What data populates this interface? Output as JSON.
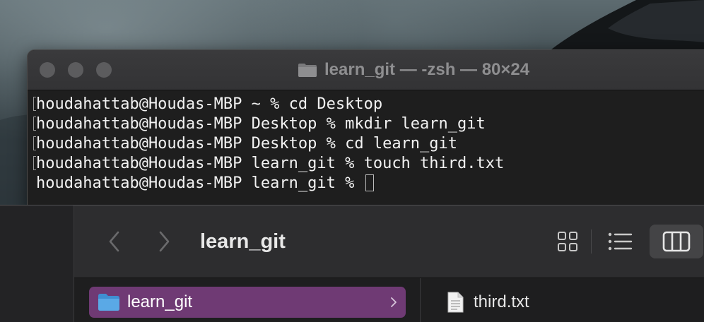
{
  "terminal": {
    "title": "learn_git — -zsh — 80×24",
    "title_icon": "folder-icon",
    "lines": [
      {
        "text": "houdahattab@Houdas-MBP ~ % cd Desktop",
        "marked": true
      },
      {
        "text": "houdahattab@Houdas-MBP Desktop % mkdir learn_git",
        "marked": true
      },
      {
        "text": "houdahattab@Houdas-MBP Desktop % cd learn_git",
        "marked": true
      },
      {
        "text": "houdahattab@Houdas-MBP learn_git % touch third.txt",
        "marked": true
      },
      {
        "text": "houdahattab@Houdas-MBP learn_git % ",
        "marked": false,
        "cursor": true
      }
    ]
  },
  "finder": {
    "title": "learn_git",
    "nav": {
      "back_icon": "chevron-left-icon",
      "forward_icon": "chevron-right-icon"
    },
    "view_modes": [
      {
        "name": "icon-view",
        "icon": "grid-icon",
        "active": false
      },
      {
        "name": "list-view",
        "icon": "list-icon",
        "active": false
      },
      {
        "name": "column-view",
        "icon": "columns-icon",
        "active": true
      }
    ],
    "selected_folder": {
      "label": "learn_git",
      "icon": "folder-icon"
    },
    "files": [
      {
        "label": "third.txt",
        "icon": "document-icon"
      }
    ]
  },
  "colors": {
    "selection": "#6f3a74",
    "folder": "#5aa9e6",
    "terminal_bg": "#1e1e1e",
    "terminal_text": "#f2f2f2"
  }
}
